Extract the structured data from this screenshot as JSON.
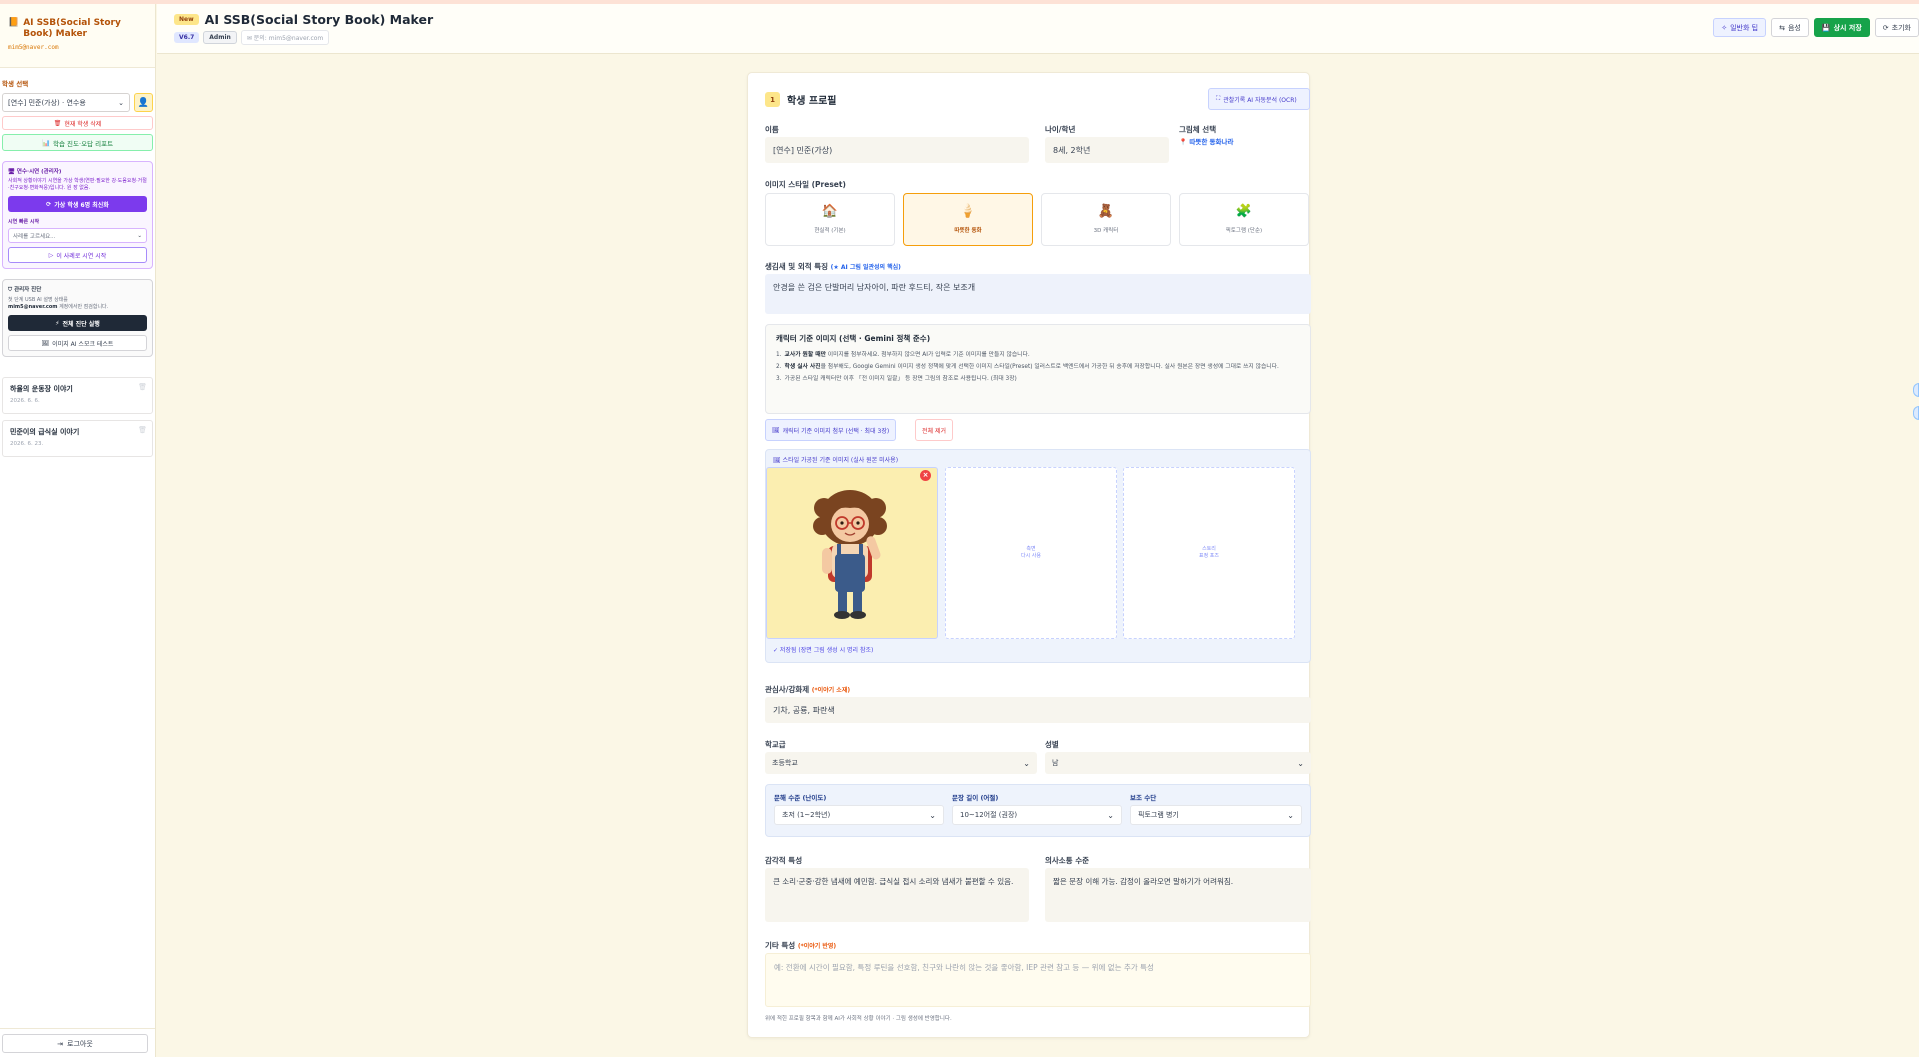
{
  "sidebar": {
    "app_title": "AI SSB(Social Story Book) Maker",
    "email": "mim5@naver.com",
    "student_section_label": "학생 선택",
    "student_select_value": "[연수] 민준(가상) · 연수용",
    "delete_student": "현재 학생 삭제",
    "progress_report": "학습 진도·오답 리포트",
    "demo_title": "연수·시연 (관리자)",
    "demo_desc": "사회적 상황이야기 시연을 가상 학생(연판·필요한 강·도움요청·거절·친구요청·변화적응)입니다. 원 장 없음.",
    "demo_reset_btn": "가상 학생 6명 최신화",
    "demo_quick_label": "시연 빠른 시작",
    "demo_quick_select": "사례를 고르세요...",
    "demo_start_btn": "이 사례로 시연 시작",
    "admin_title": "관리자 진단",
    "admin_desc_1": "첫 단계 USB AI 설명 상태를",
    "admin_desc_email": "mim5@naver.com",
    "admin_desc_2": "계정에서만 점검합니다.",
    "admin_run_btn": "전체 진단 실행",
    "admin_test_btn": "이미지 AI 스모크 테스트",
    "stories": [
      {
        "title": "하율의 운동장 이야기",
        "date": "2026. 6. 6."
      },
      {
        "title": "민준이의 급식실 이야기",
        "date": "2026. 6. 23."
      }
    ],
    "logout": "로그아웃"
  },
  "header": {
    "badge": "New",
    "title": "AI SSB(Social Story Book) Maker",
    "version": "V6.7",
    "role": "Admin",
    "contact": "문의: mim5@naver.com",
    "buttons": {
      "simplify": "일반화 팁",
      "voice": "음성",
      "save": "상시 저장",
      "reset": "초기화"
    }
  },
  "profile": {
    "step": "1",
    "section_title": "학생 프로필",
    "ocr_btn": "관찰기록 AI 자동분석 (OCR)",
    "name_label": "이름",
    "name_value": "[연수] 민준(가상)",
    "age_label": "나이/학년",
    "age_value": "8세, 2학년",
    "style_label": "그림체 선택",
    "style_value": "따뜻한 동화나라",
    "preset_label": "이미지 스타일 (Preset)",
    "presets": [
      {
        "label": "현실적 (기본)",
        "icon": "house-icon",
        "glyph": "🏠",
        "active": false
      },
      {
        "label": "따뜻한 동화",
        "icon": "ice-cream-icon",
        "glyph": "🍦",
        "active": true
      },
      {
        "label": "3D 캐릭터",
        "icon": "bear-icon",
        "glyph": "🧸",
        "active": false
      },
      {
        "label": "픽토그램 (단순)",
        "icon": "puzzle-icon",
        "glyph": "🧩",
        "active": false
      }
    ],
    "appearance_label": "생김새 및 외적 특징",
    "appearance_hint": "(★ AI 그림 일관성의 핵심)",
    "appearance_value": "안경을 쓴 검은 단발머리 남자아이, 파란 후드티, 작은 보조개",
    "ref": {
      "title": "캐릭터 기준 이미지 (선택 · Gemini 정책 준수)",
      "items": [
        {
          "num": "1.",
          "bold": "교사가 원할 때만",
          "text": " 이미지를 첨부하세요. 첨부하지 않으면 AI가 입력로 기준 이미지를 만들지 않습니다."
        },
        {
          "num": "2.",
          "bold": "학생 실사 사진",
          "text": "을 첨부해도, Google Gemini 이미지 생성 정책에 맞게 선택한 이미지 스타일(Preset) 일러스트로 백엔드에서 가공한 뒤 송후에 저장합니다. 실사 원본은 장면 생성에 그대로 쓰지 않습니다."
        },
        {
          "num": "3.",
          "bold": "",
          "text": "가공된 스타일 캐릭터만 이후 「전 이미지 일괄」 등 장면 그림의 참조로 사용됩니다. (최대 3장)"
        }
      ]
    },
    "attach_btn": "캐릭터 기준 이미지 첨부 (선택 · 최대 3장)",
    "clear_btn": "전체 제거",
    "processed_title": "스타일 가공된 기준 이미지 (실사 원본 미사용)",
    "slot2": "측면\n다시 사용",
    "slot3": "스토리\n표정 포즈",
    "saved_note": "✓ 저장됨 (장면 그림 생성 시 명리 참조)",
    "interest_label": "관심사/강화제",
    "interest_hint": "(*이야기 소재)",
    "interest_value": "기차, 공룡, 파란색",
    "school_label": "학교급",
    "school_value": "초등학교",
    "gender_label": "성별",
    "gender_value": "남",
    "reading_label": "문해 수준 (난이도)",
    "reading_value": "초저 (1~2학년)",
    "length_label": "문장 길이 (어절)",
    "length_value": "10~12어절 (권장)",
    "aid_label": "보조 수단",
    "aid_value": "픽토그램 병기",
    "sensory_label": "감각적 특성",
    "sensory_value": "큰 소리·군중·강한 냄새에 예민함. 급식실 접시 소리와 냄새가 불편할 수 있음.",
    "comm_label": "의사소통 수준",
    "comm_value": "짧은 문장 이해 가능. 감정이 올라오면 말하기가 어려워짐.",
    "other_label": "기타 특성",
    "other_hint": "(*이야기 반영)",
    "other_placeholder": "예: 전환에 시간이 필요함, 특정 루틴을 선호함, 친구와 나란히 앉는 것을 좋아함, IEP 관련 참고 등 — 위에 없는 추가 특성",
    "footnote": "위에 적힌 프로필 항목과 함께 AI가 사회적 상황 이야기 · 그림 생성에 반영합니다."
  }
}
